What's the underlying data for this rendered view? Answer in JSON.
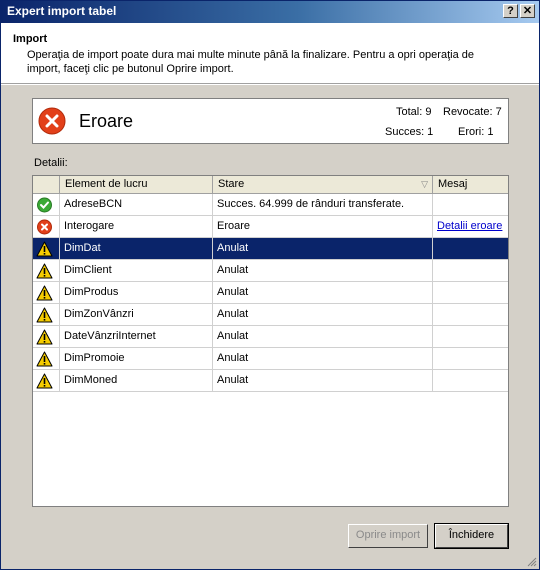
{
  "window": {
    "title": "Expert import tabel",
    "help_glyph": "?",
    "close_glyph": "✕"
  },
  "header": {
    "title": "Import",
    "description": "Operaţia de import poate dura mai multe minute până la finalizare. Pentru a opri operaţia de import, faceţi clic pe butonul Oprire import."
  },
  "status": {
    "title": "Eroare",
    "icon": "error-icon",
    "total": "Total: 9",
    "revocate": "Revocate: 7",
    "succes": "Succes: 1",
    "erori": "Erori: 1"
  },
  "details_label": "Detalii:",
  "grid": {
    "columns": [
      "Element de lucru",
      "Stare",
      "Mesaj"
    ],
    "rows": [
      {
        "icon": "success-icon",
        "item": "AdreseBCN",
        "status": "Succes. 64.999 de rânduri transferate.",
        "message": ""
      },
      {
        "icon": "error-icon",
        "item": "Interogare",
        "status": "Eroare",
        "message": "Detalii eroare"
      },
      {
        "icon": "warning-icon",
        "item": "DimDat",
        "status": "Anulat",
        "message": ""
      },
      {
        "icon": "warning-icon",
        "item": "DimClient",
        "status": "Anulat",
        "message": ""
      },
      {
        "icon": "warning-icon",
        "item": "DimProdus",
        "status": "Anulat",
        "message": ""
      },
      {
        "icon": "warning-icon",
        "item": "DimZonVânzri",
        "status": "Anulat",
        "message": ""
      },
      {
        "icon": "warning-icon",
        "item": "DateVânzriInternet",
        "status": "Anulat",
        "message": ""
      },
      {
        "icon": "warning-icon",
        "item": "DimPromoie",
        "status": "Anulat",
        "message": ""
      },
      {
        "icon": "warning-icon",
        "item": "DimMoned",
        "status": "Anulat",
        "message": ""
      }
    ],
    "selected_row": 2
  },
  "buttons": {
    "stop": "Oprire import",
    "close": "Închidere"
  },
  "colors": {
    "selection": "#0a246a",
    "error": "#e2401a",
    "success": "#3aaa35",
    "warning": "#f5cc00"
  }
}
